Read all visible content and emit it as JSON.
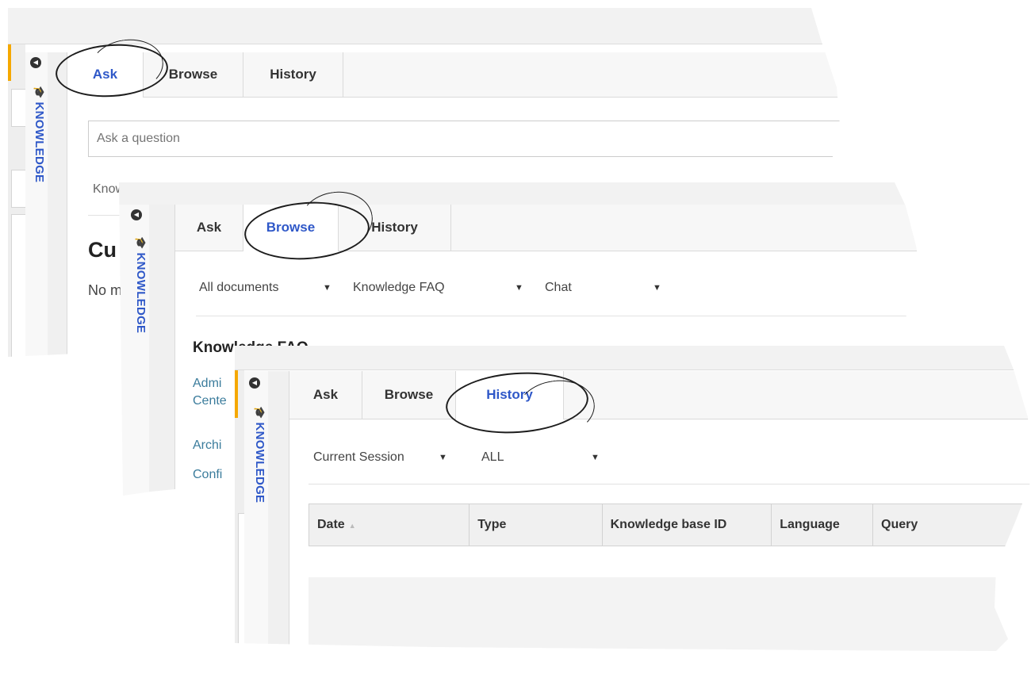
{
  "panels": {
    "ask": {
      "sidebar_label": "KNOWLEDGE",
      "tabs": [
        "Ask",
        "Browse",
        "History"
      ],
      "active_tab": "Ask",
      "input_placeholder": "Ask a question",
      "partial_text_1": "Know",
      "heading_partial": "Cu",
      "body_partial": "No m"
    },
    "browse": {
      "sidebar_label": "KNOWLEDGE",
      "tabs": [
        "Ask",
        "Browse",
        "History"
      ],
      "active_tab": "Browse",
      "filters": [
        "All documents",
        "Knowledge FAQ",
        "Chat"
      ],
      "section_heading": "Knowledge FAQ",
      "links": [
        "Admi",
        "Cente",
        "Archi",
        "Confi"
      ]
    },
    "history": {
      "sidebar_label": "KNOWLEDGE",
      "tabs": [
        "Ask",
        "Browse",
        "History"
      ],
      "active_tab": "History",
      "filters": [
        "Current Session",
        "ALL"
      ],
      "table_headers": [
        "Date",
        "Type",
        "Knowledge base ID",
        "Language",
        "Query"
      ]
    }
  },
  "icons": {
    "collapse": "circle-left-arrow-icon",
    "knowledge": "graduation-cap-icon",
    "dropdown": "triangle-down-icon",
    "sort": "triangle-up-icon"
  },
  "colors": {
    "accent_blue": "#2f58c8",
    "link_blue": "#3b7c9c",
    "orange": "#f5a800"
  }
}
